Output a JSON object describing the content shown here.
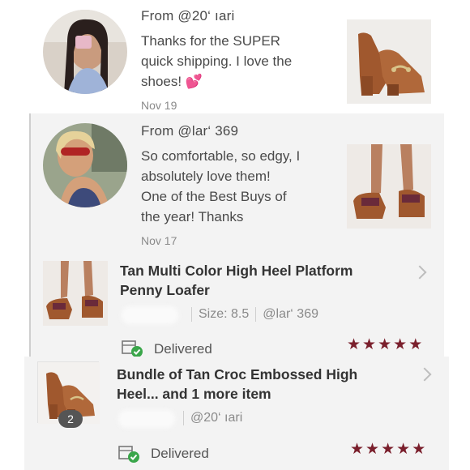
{
  "comments": [
    {
      "from": "From @20‘   ıari",
      "message_lines": [
        "Thanks for the SUPER",
        "quick shipping. I love the",
        "shoes! 💕"
      ],
      "date": "Nov 19"
    },
    {
      "from": "From @lar‘  369",
      "message_lines": [
        "So comfortable, so edgy, I",
        "absolutely love them!",
        "One of the Best Buys of",
        "the year! Thanks"
      ],
      "date": "Nov 17"
    }
  ],
  "orders": [
    {
      "title_lines": [
        "Tan Multi Color High Heel Platform",
        "Penny Loafer"
      ],
      "size": "Size: 8.5",
      "user": "@lar‘  369",
      "status": "Delivered",
      "rating": 5
    },
    {
      "title_lines": [
        "Bundle of Tan Croc Embossed High",
        "Heel... and 1 more item"
      ],
      "user": "@20‘  ıari",
      "badge": "2",
      "status": "Delivered",
      "rating": 5
    }
  ],
  "icons": {
    "star": "★",
    "delivered": "package-check-icon",
    "chevron": "chevron-right-icon"
  },
  "colors": {
    "star": "#7a1f2c",
    "check": "#3aa64a",
    "shoe": "#a0582e"
  }
}
